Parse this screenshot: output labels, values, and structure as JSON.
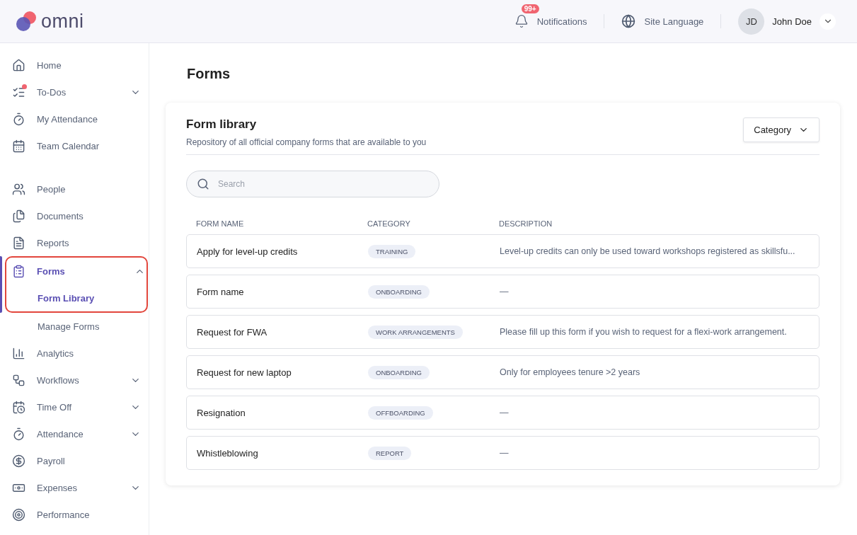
{
  "header": {
    "logo": "omni",
    "notifications": {
      "badge": "99+",
      "label": "Notifications"
    },
    "language": {
      "label": "Site Language"
    },
    "user": {
      "initials": "JD",
      "name": "John Doe"
    }
  },
  "sidebar": {
    "sections": [
      {
        "items": [
          {
            "label": "Home",
            "selected": false,
            "alert": false
          },
          {
            "label": "To-Dos",
            "selected": false,
            "alert": true,
            "expanded": false
          },
          {
            "label": "My Attendance",
            "selected": false,
            "alert": false
          },
          {
            "label": "Team Calendar",
            "selected": false,
            "alert": false
          }
        ]
      },
      {
        "items": [
          {
            "label": "People",
            "selected": false,
            "alert": false
          },
          {
            "label": "Documents",
            "selected": false,
            "alert": false
          },
          {
            "label": "Reports",
            "selected": false,
            "alert": false
          },
          {
            "label": "Forms",
            "selected": true,
            "alert": false,
            "expanded": true,
            "highlighted": true,
            "children": [
              {
                "label": "Form Library",
                "selected": true
              },
              {
                "label": "Manage Forms",
                "selected": false
              }
            ]
          },
          {
            "label": "Analytics",
            "selected": false,
            "alert": false
          },
          {
            "label": "Workflows",
            "selected": false,
            "alert": false,
            "expanded": false
          },
          {
            "label": "Time Off",
            "selected": false,
            "alert": false,
            "expanded": false
          },
          {
            "label": "Attendance",
            "selected": false,
            "alert": false,
            "expanded": false
          },
          {
            "label": "Payroll",
            "selected": false,
            "alert": false
          },
          {
            "label": "Expenses",
            "selected": false,
            "alert": false,
            "expanded": false
          },
          {
            "label": "Performance",
            "selected": false,
            "alert": false
          }
        ]
      }
    ]
  },
  "page": {
    "title": "Forms"
  },
  "library": {
    "title": "Form library",
    "subtitle": "Repository of all official company forms that are available to you",
    "filter": "Category",
    "search": {
      "placeholder": "Search"
    },
    "table": {
      "columns": [
        "FORM NAME",
        "CATEGORY",
        "DESCRIPTION"
      ],
      "rows": [
        {
          "name": "Apply for level-up credits",
          "category": "TRAINING",
          "description": "Level-up credits can only be used toward workshops registered as skillsfu..."
        },
        {
          "name": "Form name",
          "category": "ONBOARDING",
          "description": "—"
        },
        {
          "name": "Request for FWA",
          "category": "WORK ARRANGEMENTS",
          "description": "Please fill up this form if you wish to request for a flexi-work arrangement."
        },
        {
          "name": "Request for new laptop",
          "category": "ONBOARDING",
          "description": "Only for employees tenure >2 years"
        },
        {
          "name": "Resignation",
          "category": "OFFBOARDING",
          "description": "—"
        },
        {
          "name": "Whistleblowing",
          "category": "REPORT",
          "description": "—"
        }
      ]
    }
  }
}
